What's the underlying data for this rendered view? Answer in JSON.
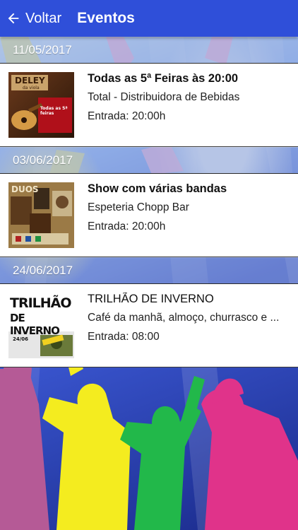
{
  "appbar": {
    "back_label": "Voltar",
    "title": "Eventos",
    "bar_color": "#2f4fd9"
  },
  "events": [
    {
      "date": "11/05/2017",
      "title": "Todas as 5ª Feiras às 20:00",
      "venue": "Total - Distribuidora de Bebidas",
      "entry": "Entrada: 20:00h",
      "thumb": {
        "line1": "DELEY",
        "line2": "da viola",
        "line3": "Todas as 5ª feiras"
      }
    },
    {
      "date": "03/06/2017",
      "title": "Show com várias bandas",
      "venue": "Espeteria Chopp Bar",
      "entry": "Entrada: 20:00h",
      "thumb": {
        "line1": "DUOS",
        "line2": "",
        "line3": ""
      }
    },
    {
      "date": "24/06/2017",
      "title": "TRILHÃO DE INVERNO",
      "venue": "Café da manhã, almoço, churrasco e ...",
      "entry": "Entrada: 08:00",
      "thumb": {
        "line1": "TRILHÃO",
        "line2": "DE INVERNO",
        "line3": "24/06"
      }
    }
  ]
}
